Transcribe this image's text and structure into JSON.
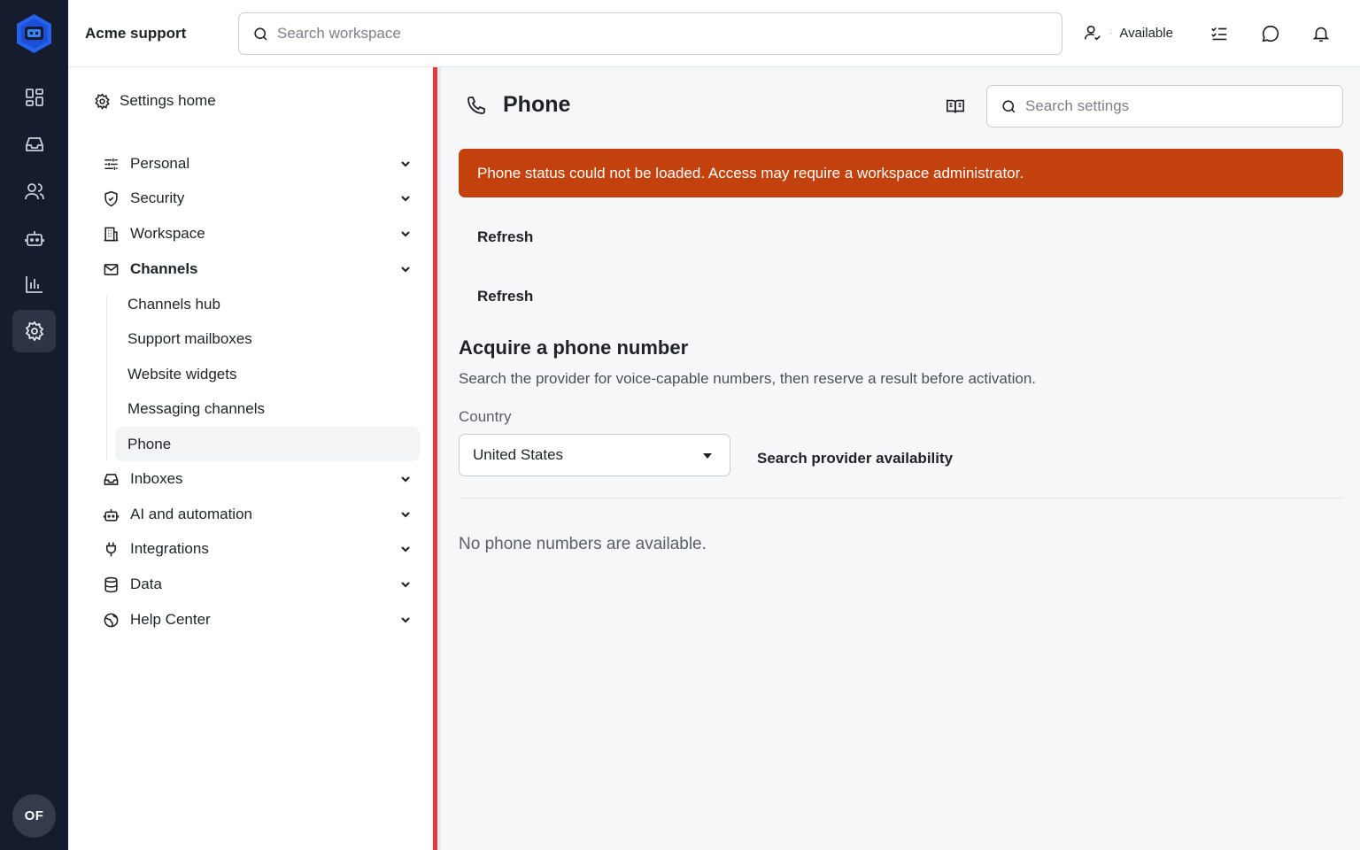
{
  "topbar": {
    "workspace_name": "Acme support",
    "search_placeholder": "Search workspace",
    "status_label": "Available"
  },
  "rail": {
    "items": [
      "dashboard-icon",
      "inbox-icon",
      "users-icon",
      "bot-icon",
      "chart-icon",
      "gear-icon"
    ],
    "active": "gear-icon",
    "avatar_initials": "OF"
  },
  "sidebar": {
    "home_label": "Settings home",
    "sections": [
      {
        "label": "Personal",
        "icon": "sliders-icon"
      },
      {
        "label": "Security",
        "icon": "shield-icon"
      },
      {
        "label": "Workspace",
        "icon": "building-icon"
      },
      {
        "label": "Channels",
        "icon": "mail-icon",
        "expanded": true
      },
      {
        "label": "Inboxes",
        "icon": "inbox-icon"
      },
      {
        "label": "AI and automation",
        "icon": "bot-icon"
      },
      {
        "label": "Integrations",
        "icon": "plug-icon"
      },
      {
        "label": "Data",
        "icon": "database-icon"
      },
      {
        "label": "Help Center",
        "icon": "globe-icon"
      }
    ],
    "channel_items": [
      "Channels hub",
      "Support mailboxes",
      "Website widgets",
      "Messaging channels",
      "Phone"
    ],
    "active_channel": "Phone"
  },
  "main": {
    "title": "Phone",
    "settings_search_placeholder": "Search settings",
    "alert": "Phone status could not be loaded. Access may require a workspace administrator.",
    "refresh_1": "Refresh",
    "refresh_2": "Refresh",
    "acquire_title": "Acquire a phone number",
    "acquire_desc": "Search the provider for voice-capable numbers, then reserve a result before activation.",
    "country_label": "Country",
    "country_value": "United States",
    "search_provider_label": "Search provider availability",
    "empty_state": "No phone numbers are available."
  },
  "colors": {
    "rail_bg": "#151c2e",
    "alert_bg": "#c2410c",
    "divider_accent": "#e5383f",
    "logo_blue": "#2563eb"
  }
}
